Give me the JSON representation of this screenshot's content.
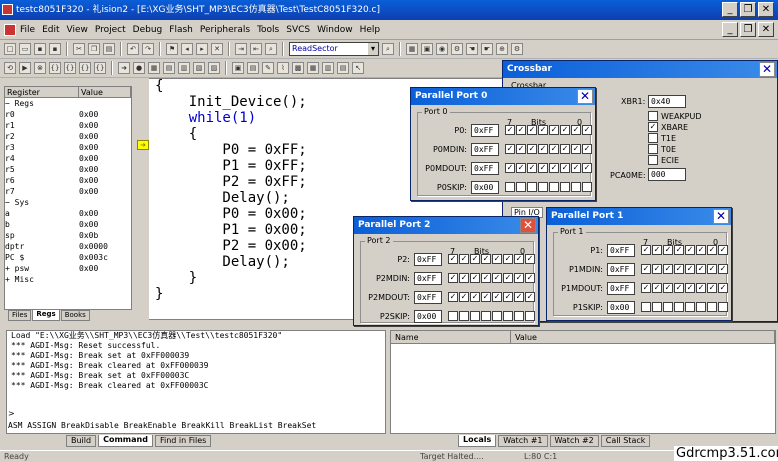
{
  "window": {
    "title": "testc8051F320 - 礼ision2 - [E:\\XG业务\\SHT_MP3\\EC3仿真器\\Test\\TestC8051F320.c]",
    "minimize": "_",
    "restore": "❐",
    "close": "✕"
  },
  "menu": {
    "items": [
      "File",
      "Edit",
      "View",
      "Project",
      "Debug",
      "Flash",
      "Peripherals",
      "Tools",
      "SVCS",
      "Window",
      "Help"
    ],
    "mdi_min": "_",
    "mdi_restore": "❐",
    "mdi_close": "✕"
  },
  "toolbar": {
    "function_combo": "ReadSector"
  },
  "registers": {
    "header": {
      "name": "Register",
      "value": "Value"
    },
    "rows": [
      {
        "name": "− Regs",
        "value": ""
      },
      {
        "name": "   r0",
        "value": "0x00"
      },
      {
        "name": "   r1",
        "value": "0x00"
      },
      {
        "name": "   r2",
        "value": "0x00"
      },
      {
        "name": "   r3",
        "value": "0x00"
      },
      {
        "name": "   r4",
        "value": "0x00"
      },
      {
        "name": "   r5",
        "value": "0x00"
      },
      {
        "name": "   r6",
        "value": "0x00"
      },
      {
        "name": "   r7",
        "value": "0x00"
      },
      {
        "name": "− Sys",
        "value": ""
      },
      {
        "name": "   a",
        "value": "0x00"
      },
      {
        "name": "   b",
        "value": "0x00"
      },
      {
        "name": "   sp",
        "value": "0x0b"
      },
      {
        "name": "   dptr",
        "value": "0x0000"
      },
      {
        "name": "   PC  $",
        "value": "0x003c"
      },
      {
        "name": " + psw",
        "value": "0x00"
      },
      {
        "name": " + Misc",
        "value": ""
      }
    ],
    "tabs": [
      "Files",
      "Regs",
      "Books"
    ]
  },
  "code": {
    "lines": [
      "{",
      "    Init_Device();",
      "    while(1)",
      "    {",
      "        P0 = 0xFF;",
      "        P1 = 0xFF;",
      "        P2 = 0xFF;",
      "        Delay();",
      "        P0 = 0x00;",
      "        P1 = 0x00;",
      "        P2 = 0x00;",
      "        Delay();",
      "    }",
      "}"
    ]
  },
  "crossbar": {
    "title": "Crossbar",
    "partial_label": "Crossbar",
    "xbr1_label": "XBR1:",
    "xbr1_value": "0x40",
    "options": [
      {
        "label": "WEAKPUD",
        "checked": ""
      },
      {
        "label": "XBARE",
        "checked": "✓"
      },
      {
        "label": "T1E",
        "checked": ""
      },
      {
        "label": "T0E",
        "checked": ""
      },
      {
        "label": "ECIE",
        "checked": ""
      }
    ],
    "pca_label": "PCA0ME:",
    "pca_value": "000",
    "pin_io_partial": "Pin I/O"
  },
  "port0": {
    "title": "Parallel Port 0",
    "group": "Port 0",
    "bits_hdr": {
      "seven": "7",
      "bits": "Bits",
      "zero": "0"
    },
    "rows": [
      {
        "label": "P0:",
        "value": "0xFF",
        "bits": [
          "✓",
          "✓",
          "✓",
          "✓",
          "✓",
          "✓",
          "✓",
          "✓"
        ]
      },
      {
        "label": "P0MDIN:",
        "value": "0xFF",
        "bits": [
          "✓",
          "✓",
          "✓",
          "✓",
          "✓",
          "✓",
          "✓",
          "✓"
        ]
      },
      {
        "label": "P0MDOUT:",
        "value": "0xFF",
        "bits": [
          "✓",
          "✓",
          "✓",
          "✓",
          "✓",
          "✓",
          "✓",
          "✓"
        ]
      },
      {
        "label": "P0SKIP:",
        "value": "0x00",
        "bits": [
          "",
          "",
          "",
          "",
          "",
          "",
          "",
          ""
        ]
      }
    ]
  },
  "port2": {
    "title": "Parallel Port 2",
    "group": "Port 2",
    "bits_hdr": {
      "seven": "7",
      "bits": "Bits",
      "zero": "0"
    },
    "rows": [
      {
        "label": "P2:",
        "value": "0xFF",
        "bits": [
          "✓",
          "✓",
          "✓",
          "✓",
          "✓",
          "✓",
          "✓",
          "✓"
        ]
      },
      {
        "label": "P2MDIN:",
        "value": "0xFF",
        "bits": [
          "✓",
          "✓",
          "✓",
          "✓",
          "✓",
          "✓",
          "✓",
          "✓"
        ]
      },
      {
        "label": "P2MDOUT:",
        "value": "0xFF",
        "bits": [
          "✓",
          "✓",
          "✓",
          "✓",
          "✓",
          "✓",
          "✓",
          "✓"
        ]
      },
      {
        "label": "P2SKIP:",
        "value": "0x00",
        "bits": [
          "",
          "",
          "",
          "",
          "",
          "",
          "",
          ""
        ]
      }
    ]
  },
  "port1": {
    "title": "Parallel Port 1",
    "group": "Port 1",
    "bits_hdr": {
      "seven": "7",
      "bits": "Bits",
      "zero": "0"
    },
    "rows": [
      {
        "label": "P1:",
        "value": "0xFF",
        "bits": [
          "✓",
          "✓",
          "✓",
          "✓",
          "✓",
          "✓",
          "✓",
          "✓"
        ]
      },
      {
        "label": "P1MDIN:",
        "value": "0xFF",
        "bits": [
          "✓",
          "✓",
          "✓",
          "✓",
          "✓",
          "✓",
          "✓",
          "✓"
        ]
      },
      {
        "label": "P1MDOUT:",
        "value": "0xFF",
        "bits": [
          "✓",
          "✓",
          "✓",
          "✓",
          "✓",
          "✓",
          "✓",
          "✓"
        ]
      },
      {
        "label": "P1SKIP:",
        "value": "0x00",
        "bits": [
          "",
          "",
          "",
          "",
          "",
          "",
          "",
          ""
        ]
      }
    ]
  },
  "output": {
    "lines": [
      "Load \"E:\\\\XG业务\\\\SHT_MP3\\\\EC3仿真器\\\\Test\\\\testc8051F320\"",
      "*** AGDI-Msg: Reset successful.",
      "*** AGDI-Msg: Break set at 0xFF000039",
      "*** AGDI-Msg: Break cleared at 0xFF000039",
      "*** AGDI-Msg: Break set at 0xFF00003C",
      "*** AGDI-Msg: Break cleared at 0xFF00003C"
    ],
    "prompt": ">",
    "command_hint": "ASM ASSIGN BreakDisable BreakEnable BreakKill BreakList BreakSet",
    "tabs": [
      "Build",
      "Command",
      "Find in Files"
    ]
  },
  "watch": {
    "header": {
      "name": "Name",
      "value": "Value"
    },
    "tabs": [
      "Locals",
      "Watch #1",
      "Watch #2",
      "Call Stack"
    ]
  },
  "status": {
    "ready": "Ready",
    "target": "Target Halted....",
    "position": "L:80 C:1"
  },
  "watermark": "Gdrcmp3.51.com"
}
